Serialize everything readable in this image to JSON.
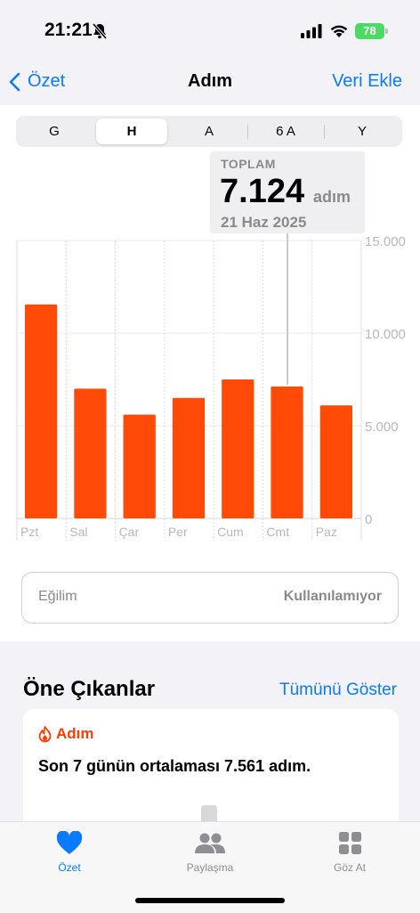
{
  "status": {
    "time": "21:21",
    "battery": "78"
  },
  "nav": {
    "back": "Özet",
    "title": "Adım",
    "add": "Veri Ekle"
  },
  "segments": [
    "G",
    "H",
    "A",
    "6 A",
    "Y"
  ],
  "selected_segment": "H",
  "tooltip": {
    "label": "TOPLAM",
    "value": "7.124",
    "unit": "adım",
    "date": "21 Haz 2025"
  },
  "chart_data": {
    "type": "bar",
    "categories": [
      "Pzt",
      "Sal",
      "Çar",
      "Per",
      "Cum",
      "Cmt",
      "Paz"
    ],
    "values": [
      11550,
      7000,
      5600,
      6500,
      7500,
      7124,
      6100
    ],
    "yticks": [
      "15.000",
      "10.000",
      "5.000",
      "0"
    ],
    "ylim": [
      0,
      15000
    ],
    "highlight_index": 5,
    "bar_color": "#ff4a08"
  },
  "trend": {
    "label": "Eğilim",
    "value": "Kullanılamıyor"
  },
  "highlights": {
    "title": "Öne Çıkanlar",
    "show_all": "Tümünü Göster",
    "card_title": "Adım",
    "card_text": "Son 7 günün ortalaması 7.561 adım."
  },
  "tabs": [
    {
      "label": "Özet",
      "icon": "heart-icon",
      "active": true
    },
    {
      "label": "Paylaşma",
      "icon": "people-icon",
      "active": false
    },
    {
      "label": "Göz At",
      "icon": "grid-icon",
      "active": false
    }
  ],
  "colors": {
    "accent": "#0a7aff",
    "bar": "#ff4a08",
    "flame": "#ff3b00"
  }
}
